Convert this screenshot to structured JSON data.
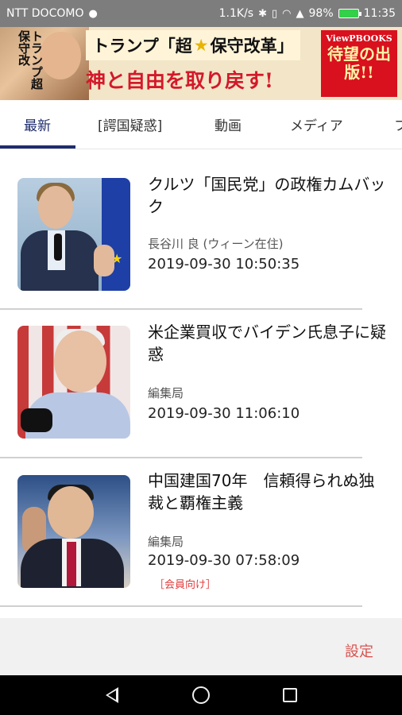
{
  "status_bar": {
    "carrier": "NTT DOCOMO",
    "speed": "1.1K/s",
    "battery_pct": "98%",
    "time": "11:35",
    "icons": [
      "message-icon",
      "bluetooth-icon",
      "vibrate-icon",
      "wifi-icon",
      "signal-icon",
      "battery-icon"
    ]
  },
  "banner": {
    "vertical_text": "トランプ超保守改",
    "title_left": "トランプ「超",
    "title_star": "★",
    "title_right": "保守改革」",
    "subtitle": "神と自由を取り戻す!",
    "publisher": "ViewPBOOKS",
    "publisher_text": "待望の出版!!"
  },
  "tabs": [
    {
      "label": "最新",
      "active": true
    },
    {
      "label": "[諤国疑惑]",
      "active": false
    },
    {
      "label": "動画",
      "active": false
    },
    {
      "label": "メディア",
      "active": false
    },
    {
      "label": "フ",
      "active": false
    }
  ],
  "articles": [
    {
      "title": "クルツ「国民党」の政権カムバック",
      "author": "長谷川 良 (ウィーン在住)",
      "date": "2019-09-30 10:50:35",
      "badge": ""
    },
    {
      "title": "米企業買収でバイデン氏息子に疑惑",
      "author": "編集局",
      "date": "2019-09-30 11:06:10",
      "badge": ""
    },
    {
      "title": "中国建国70年　信頼得られぬ独裁と覇権主義",
      "author": "編集局",
      "date": "2019-09-30 07:58:09",
      "badge": "［会員向け］"
    }
  ],
  "footer": {
    "settings_label": "設定"
  },
  "colors": {
    "accent": "#1f2d6e",
    "settings": "#d9534f",
    "badge": "#e23a3a"
  }
}
